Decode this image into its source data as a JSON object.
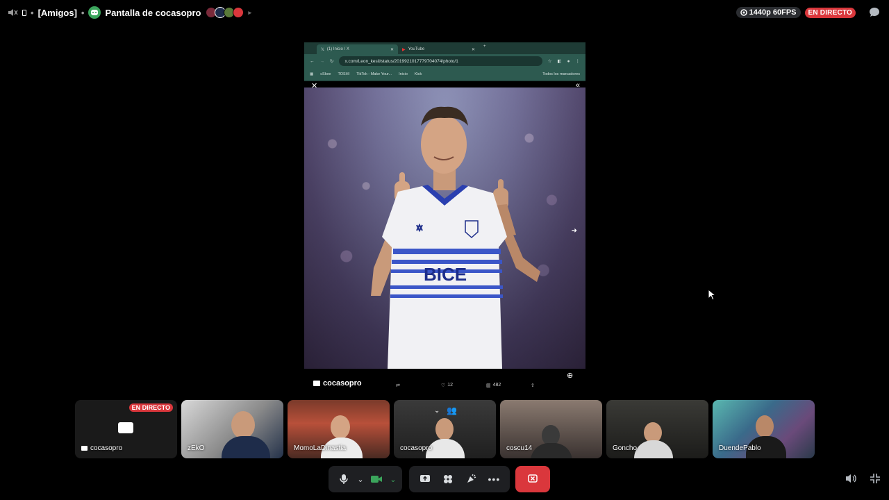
{
  "topbar": {
    "server_label": "[Amigos]",
    "separator": "•",
    "channel_title": "Pantalla de cocasopro",
    "quality": "1440p 60FPS",
    "live": "EN DIRECTO"
  },
  "shared_screen": {
    "browser": {
      "tabs": [
        {
          "label": "(1) Inicio / X",
          "icon": "x-logo-icon"
        },
        {
          "label": "YouTube",
          "icon": "youtube-icon"
        }
      ],
      "url": "x.com/Leon_kesil/status/2019921017779704074/photo/1",
      "bookmarks": [
        "cSkee",
        "TOSHI",
        "TikTok - Make Your...",
        "Inicio",
        "Kick"
      ],
      "bookmarks_folder": "Todos los marcadores"
    },
    "photo_text": "BICE",
    "tweet": {
      "likes": "12",
      "views": "482"
    },
    "owner": "cocasopro"
  },
  "participants": [
    {
      "name": "cocasopro",
      "live": "EN DIRECTO",
      "streaming": true
    },
    {
      "name": "zEkO"
    },
    {
      "name": "MomoLaDinastia"
    },
    {
      "name": "cocasopro"
    },
    {
      "name": "coscu14"
    },
    {
      "name": "Goncho"
    },
    {
      "name": "DuendePablo"
    }
  ],
  "colors": {
    "accent_red": "#da373c",
    "accent_green": "#3ba55c",
    "panel": "#1e1f22"
  }
}
